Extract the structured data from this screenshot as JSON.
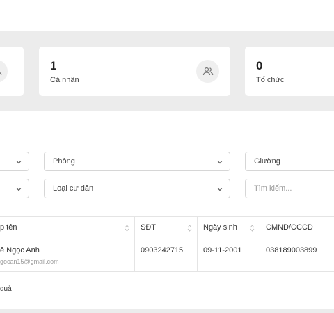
{
  "stats": [
    {
      "count": "1",
      "label": "Cá nhân",
      "icon": "users-icon"
    },
    {
      "count": "0",
      "label": "Tổ chức",
      "icon": "users-icon"
    }
  ],
  "filters": {
    "room_label": "Phòng",
    "bed_label": "Giường",
    "resident_type_label": "Loại cư dân",
    "search_placeholder": "Tìm kiếm..."
  },
  "table": {
    "columns": [
      "p tên",
      "SĐT",
      "Ngày sinh",
      "CMND/CCCD"
    ],
    "rows": [
      {
        "name": "ê Ngọc Anh",
        "email": "gocan15@gmail.com",
        "phone": "0903242715",
        "dob": "09-11-2001",
        "id_number": "038189003899"
      }
    ]
  },
  "result_text": "quả"
}
